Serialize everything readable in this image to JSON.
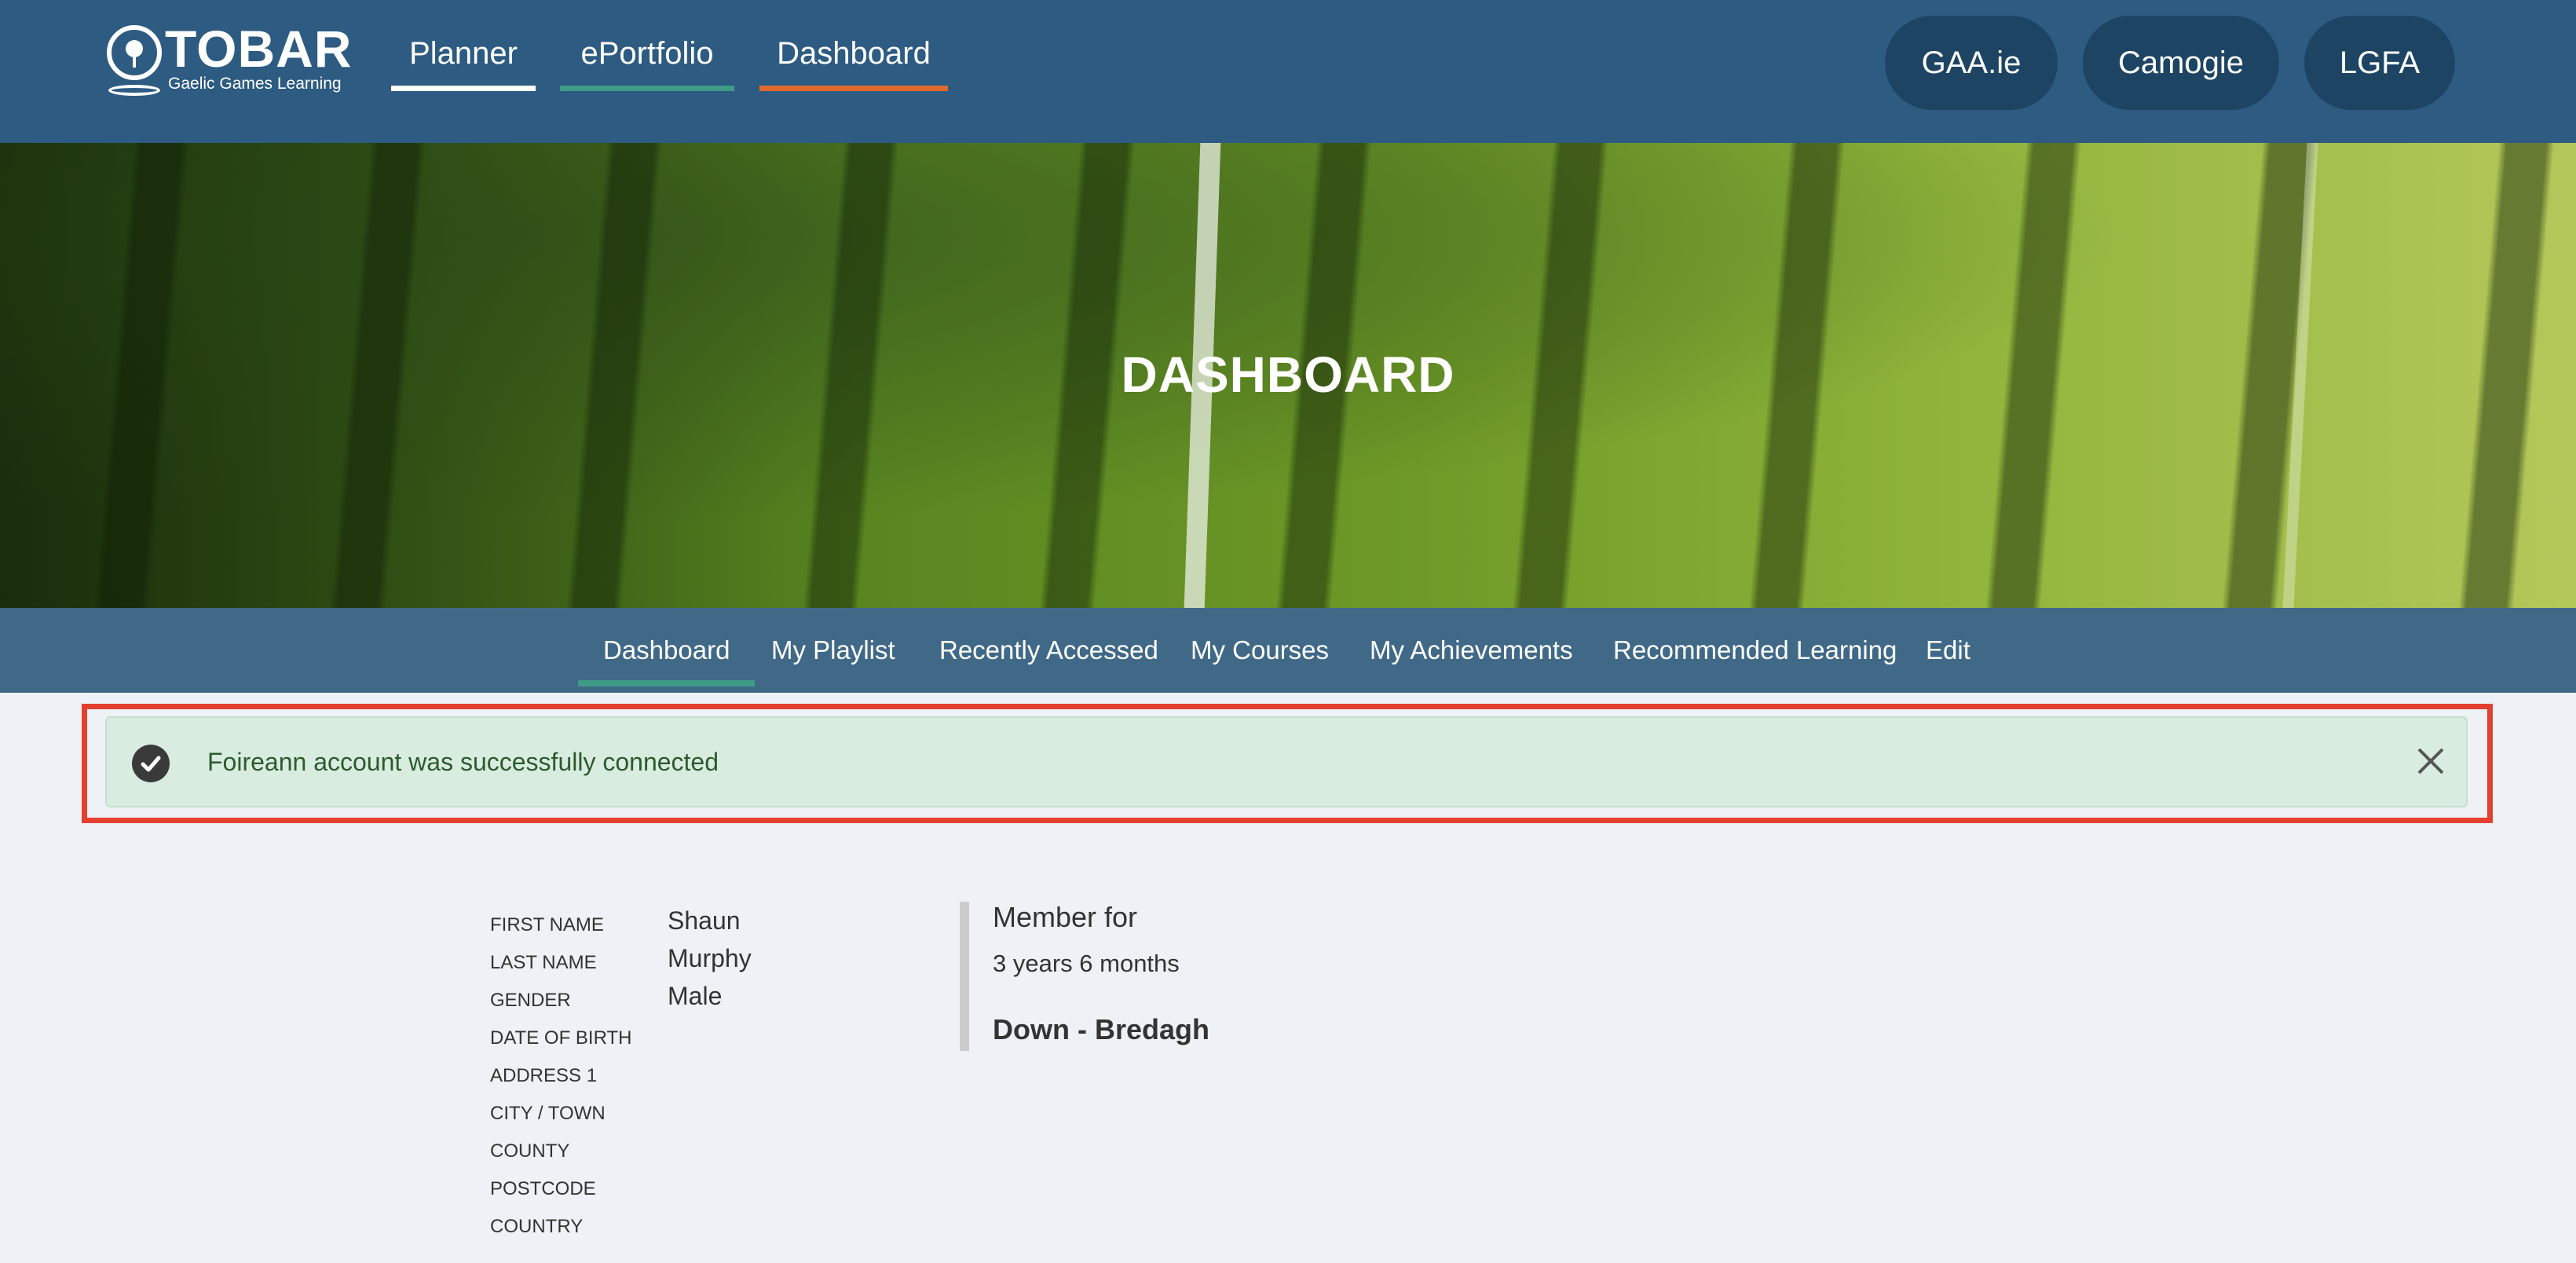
{
  "header": {
    "logo_name": "TOBAR",
    "logo_tagline": "Gaelic Games Learning",
    "nav": [
      {
        "label": "Planner",
        "accent": "#ffffff"
      },
      {
        "label": "ePortfolio",
        "accent": "#3e9c86"
      },
      {
        "label": "Dashboard",
        "accent": "#e06a2d"
      }
    ],
    "external_links": [
      "GAA.ie",
      "Camogie",
      "LGFA"
    ]
  },
  "hero": {
    "title": "DASHBOARD"
  },
  "tabs": {
    "items": [
      "Dashboard",
      "My Playlist",
      "Recently Accessed",
      "My Courses",
      "My Achievements",
      "Recommended Learning",
      "Edit"
    ],
    "active": "Dashboard"
  },
  "alert": {
    "message": "Foireann account was successfully connected",
    "icon": "check-circle-icon",
    "highlight_color": "#e3402f"
  },
  "profile": {
    "labels": [
      "First name",
      "Last name",
      "Gender",
      "Date of birth",
      "Address 1",
      "City / Town",
      "County",
      "Postcode",
      "Country"
    ],
    "values": [
      "Shaun",
      "Murphy",
      "Male"
    ]
  },
  "membership": {
    "title": "Member for",
    "duration": "3 years 6 months",
    "club": "Down - Bredagh"
  },
  "colors": {
    "header_bg": "#2d5b82",
    "pill_bg": "#1d4563",
    "alert_bg": "#d8ece0",
    "page_bg": "#eef2f6"
  }
}
